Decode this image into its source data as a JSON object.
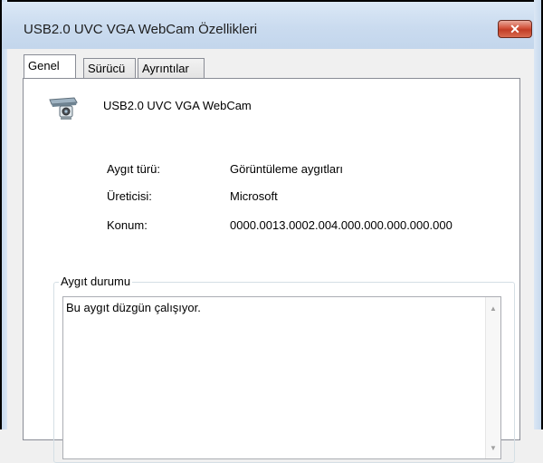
{
  "window": {
    "title": "USB2.0 UVC VGA WebCam Özellikleri",
    "close_glyph": "✕"
  },
  "tabs": [
    {
      "label": "Genel",
      "active": true
    },
    {
      "label": "Sürücü",
      "active": false
    },
    {
      "label": "Ayrıntılar",
      "active": false
    }
  ],
  "device": {
    "name": "USB2.0 UVC VGA WebCam",
    "icon": "webcam-icon"
  },
  "properties": [
    {
      "label": "Aygıt türü:",
      "value": "Görüntüleme aygıtları"
    },
    {
      "label": "Üreticisi:",
      "value": "Microsoft"
    },
    {
      "label": "Konum:",
      "value": "0000.0013.0002.004.000.000.000.000.000"
    }
  ],
  "status_group": {
    "legend": "Aygıt durumu",
    "text": "Bu aygıt düzgün çalışıyor."
  },
  "scrollbar": {
    "up_glyph": "▲",
    "down_glyph": "▼"
  }
}
